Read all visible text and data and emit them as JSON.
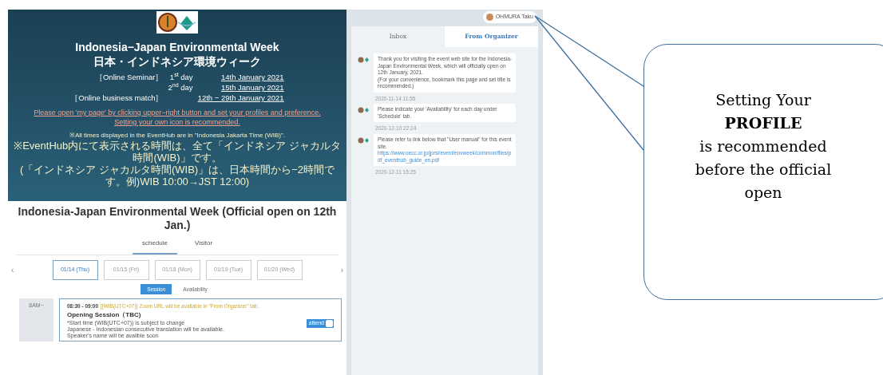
{
  "banner": {
    "title_en": "Indonesia−Japan Environmental Week",
    "title_ja": "日本・インドネシア環境ウィーク",
    "dates": [
      {
        "label": "［Online Seminar］",
        "day": "1$^{st}$ day",
        "date": "14th January 2021"
      },
      {
        "day": "2$^{nd}$ day",
        "date": "15th January 2021"
      },
      {
        "label": "［Online business match］",
        "date": "12th − 29th January 2021"
      }
    ],
    "notice": [
      "Please open 'my page' by clicking upper−right button and set your profiles and preference.",
      "Setting your own icon is recommended."
    ],
    "timezone_notes": [
      "※All times displayed in the EventHub are in \"Indonesia Jakarta Time (WIB)\".",
      "※EventHub内にて表示される時間は、全て「インドネシア ジャカルタ時間(WIB)」です。",
      "(「インドネシア ジャカルタ時間(WIB)」は、日本時間から−2時間です。例)WIB 10:00→JST 12:00)"
    ]
  },
  "heading": "Indonesia-Japan Environmental Week (Official open on 12th Jan.)",
  "tabs": [
    {
      "label": "schedule",
      "selected": true
    },
    {
      "label": "Visitor",
      "selected": false
    }
  ],
  "prev_arrow": "‹",
  "next_arrow": "›",
  "days": [
    {
      "label": "01/14 (Thu)",
      "selected": true
    },
    {
      "label": "01/15 (Fri)",
      "selected": false
    },
    {
      "label": "01/18 (Mon)",
      "selected": false
    },
    {
      "label": "01/19 (Tue)",
      "selected": false
    },
    {
      "label": "01/20 (Wed)",
      "selected": false
    }
  ],
  "views": [
    {
      "label": "Session",
      "selected": true
    },
    {
      "label": "Availability",
      "selected": false
    }
  ],
  "sessions": [
    {
      "hour": "8AM~",
      "time": "08:30 - 09:00",
      "note": "[[WIB(UTC+07)] Zoom URL will be available in \"From Organizer\" tab.",
      "title": "Opening Session（TBC)",
      "details": [
        "*Start time (WIB(UTC+07)) is subject to change",
        "Japanese - Indonesian consecutive translation will be available.",
        "Speaker's name will be availble soon"
      ],
      "attend_label": "attend",
      "attend": false
    }
  ],
  "user": {
    "name": "OHMURA Taku"
  },
  "message_tabs": [
    {
      "label": "Inbox",
      "selected": false
    },
    {
      "label": "From Organizer",
      "selected": true
    }
  ],
  "messages": [
    {
      "lines": [
        "Thank you for visiting the event web site for the Indonesia-Japan Environmental Week, which will officially open on 12th January, 2021.",
        "(For your convenience, bookmark this page and set title is recommended.)"
      ],
      "time": "2020-11-14 11:55"
    },
    {
      "lines": [
        "Please indicate your 'Availability' for each day under 'Schedule' tab."
      ],
      "time": "2020-12-10 22:24"
    },
    {
      "lines": [
        "Please refer to link below that \"User manual\" for this event site."
      ],
      "link": "https://www.oecc.or.jp/jprsi/event/envweek/common/files/pdf_eventhub_guide_en.pdf",
      "time": "2020-12-11 15:25"
    }
  ],
  "callout": {
    "lines": [
      "Setting Your",
      "PROFILE",
      "is recommended",
      "before the official",
      "open"
    ]
  }
}
